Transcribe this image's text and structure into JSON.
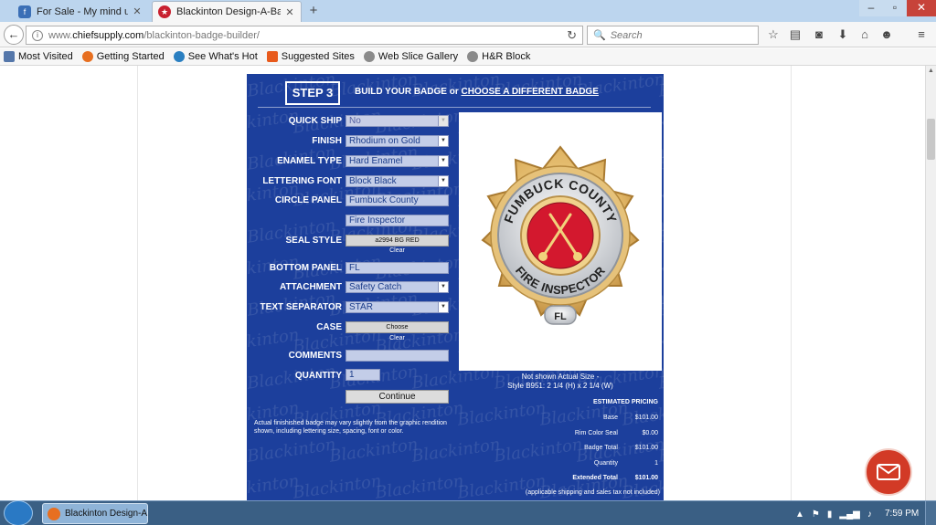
{
  "browser": {
    "tabs": [
      {
        "title": "For Sale - My mind us goin...",
        "active": false
      },
      {
        "title": "Blackinton Design-A-Badg...",
        "active": true
      }
    ],
    "url_prefix": "www.",
    "url_domain": "chiefsupply.com",
    "url_path": "/blackinton-badge-builder/",
    "search_placeholder": "Search",
    "bookmarks": [
      "Most Visited",
      "Getting Started",
      "See What's Hot",
      "Suggested Sites",
      "Web Slice Gallery",
      "H&R Block"
    ]
  },
  "builder": {
    "step_label": "STEP 3",
    "heading": "BUILD YOUR BADGE or ",
    "choose_link": "CHOOSE A DIFFERENT BADGE",
    "fields": {
      "quick_ship": {
        "label": "QUICK SHIP",
        "value": "No"
      },
      "finish": {
        "label": "FINISH",
        "value": "Rhodium on Gold"
      },
      "enamel_type": {
        "label": "ENAMEL TYPE",
        "value": "Hard Enamel"
      },
      "lettering_font": {
        "label": "LETTERING FONT",
        "value": "Block Black"
      },
      "circle_panel": {
        "label": "CIRCLE PANEL",
        "value1": "Fumbuck County",
        "value2": "Fire Inspector"
      },
      "seal_style": {
        "label": "SEAL STYLE",
        "button": "a2994 BG RED",
        "clear": "Clear"
      },
      "bottom_panel": {
        "label": "BOTTOM PANEL",
        "value": "FL"
      },
      "attachment": {
        "label": "ATTACHMENT",
        "value": "Safety Catch"
      },
      "text_separator": {
        "label": "TEXT SEPARATOR",
        "value": "STAR"
      },
      "case": {
        "label": "CASE",
        "button": "Choose",
        "clear": "Clear"
      },
      "comments": {
        "label": "COMMENTS",
        "value": ""
      },
      "quantity": {
        "label": "QUANTITY",
        "value": "1"
      }
    },
    "continue_label": "Continue",
    "disclaimer": "Actual finishished badge may vary slightly from the graphic rendition shown, including lettering size, spacing, font or color.",
    "badge_preview": {
      "top_text": "FUMBUCK COUNTY",
      "bottom_text": "FIRE INSPECTOR",
      "panel_text": "FL"
    },
    "size_caption_line1": "Not shown Actual Size -",
    "size_caption_line2": "Style B951: 2 1/4 (H) x 2 1/4 (W)",
    "pricing": {
      "title": "ESTIMATED PRICING",
      "rows": [
        {
          "label": "Base",
          "value": "$101.00"
        },
        {
          "label": "Rim Color Seal",
          "value": "$0.00"
        },
        {
          "label": "Badge Total",
          "value": "$101.00"
        },
        {
          "label": "Quantity",
          "value": "1"
        },
        {
          "label": "Extended Total",
          "value": "$101.00"
        }
      ],
      "note": "(applicable shipping and sales tax not included)"
    },
    "watermark": "Blackinton"
  },
  "taskbar": {
    "task_label": "Blackinton Design-A...",
    "clock": "7:59 PM"
  },
  "colors": {
    "builder_bg": "#1c3f9c",
    "badge_gold": "#e2b96a",
    "badge_red": "#d3182e",
    "mail_fab": "#d23a26"
  }
}
